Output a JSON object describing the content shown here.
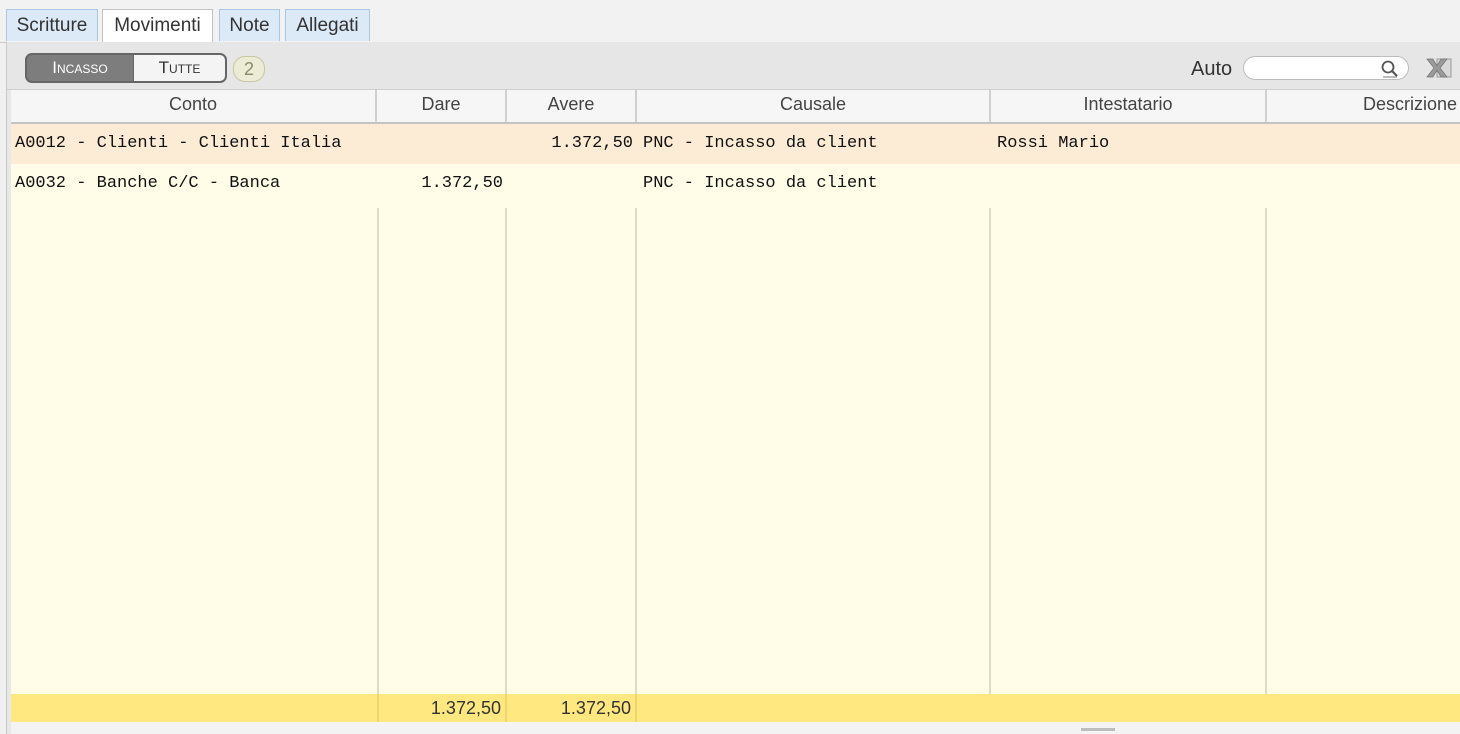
{
  "tabs": [
    {
      "label": "Scritture",
      "active": false
    },
    {
      "label": "Movimenti",
      "active": true
    },
    {
      "label": "Note",
      "active": false
    },
    {
      "label": "Allegati",
      "active": false
    }
  ],
  "toolbar": {
    "filter_options": [
      "Incasso",
      "Tutte"
    ],
    "selected_filter": "Incasso",
    "count": "2",
    "auto_label": "Auto",
    "search_value": ""
  },
  "table": {
    "columns": [
      "Conto",
      "Dare",
      "Avere",
      "Causale",
      "Intestatario",
      "Descrizione"
    ],
    "rows": [
      {
        "conto": "A0012 - Clienti - Clienti Italia",
        "dare": "",
        "avere": "1.372,50",
        "causale": "PNC - Incasso da client",
        "intestatario": "Rossi Mario",
        "descrizione": ""
      },
      {
        "conto": "A0032 - Banche C/C - Banca",
        "dare": "1.372,50",
        "avere": "",
        "causale": "PNC - Incasso da client",
        "intestatario": "",
        "descrizione": ""
      }
    ],
    "totals": {
      "dare": "1.372,50",
      "avere": "1.372,50"
    }
  },
  "colors": {
    "selected_row": "#fdecd5",
    "grid_background": "#fffde8",
    "totals_bar": "#ffe880",
    "tab_inactive": "#dce9f7"
  }
}
